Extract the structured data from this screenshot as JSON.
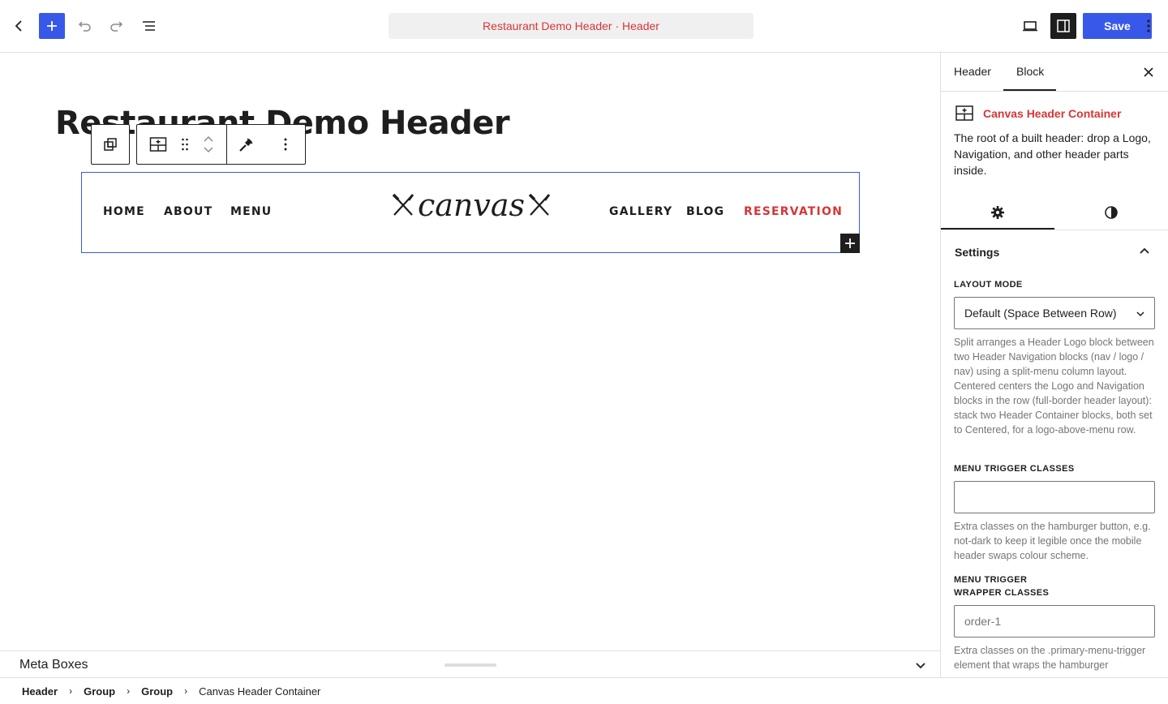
{
  "topbar": {
    "document_title": "Restaurant Demo Header · Header",
    "save_label": "Save"
  },
  "canvas": {
    "page_title": "Restaurant Demo Header",
    "nav_left": [
      "HOME",
      "ABOUT",
      "MENU"
    ],
    "logo_text": "canvas",
    "nav_right": [
      "GALLERY",
      "BLOG",
      "RESERVATION"
    ]
  },
  "meta": {
    "label": "Meta Boxes"
  },
  "breadcrumb": {
    "items": [
      "Header",
      "Group",
      "Group"
    ],
    "current": "Canvas Header Container"
  },
  "sidebar": {
    "tabs": [
      "Header",
      "Block"
    ],
    "active_tab": "Block",
    "block_title": "Canvas Header Container",
    "block_description": "The root of a built header: drop a Logo, Navigation, and other header parts inside.",
    "panel_title": "Settings",
    "layout_mode_label": "LAYOUT MODE",
    "layout_mode_value": "Default (Space Between Row)",
    "layout_mode_help": "Split arranges a Header Logo block between two Header Navigation blocks (nav / logo / nav) using a split-menu column layout. Centered centers the Logo and Navigation blocks in the row (full-border header layout): stack two Header Container blocks, both set to Centered, for a logo-above-menu row.",
    "menu_trigger_label": "MENU TRIGGER CLASSES",
    "menu_trigger_value": "",
    "menu_trigger_help": "Extra classes on the hamburger button, e.g. not-dark to keep it legible once the mobile header swaps colour scheme.",
    "wrapper_label": "MENU TRIGGER WRAPPER CLASSES",
    "wrapper_value": "order-1",
    "wrapper_help": "Extra classes on the .primary-menu-trigger element that wraps the hamburger"
  },
  "colors": {
    "accent": "#3858e9",
    "brand_red": "#d63638",
    "text": "#1e1e1e"
  }
}
